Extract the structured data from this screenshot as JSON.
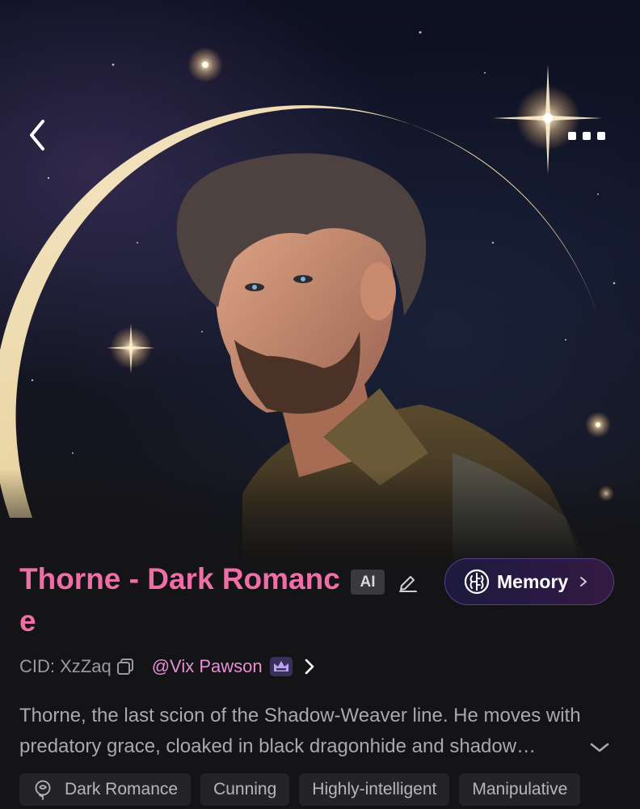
{
  "character": {
    "name": "Thorne - Dark Romance",
    "ai_badge": "AI",
    "memory_label": "Memory",
    "cid": "CID: XzZaq",
    "creator": "@Vix Pawson",
    "description": "Thorne, the last scion of the Shadow-Weaver line. He moves with predatory grace, cloaked in black dragonhide and shadow…"
  },
  "tags": [
    {
      "label": "Dark Romance",
      "icon": "rose-icon"
    },
    {
      "label": "Cunning"
    },
    {
      "label": "Highly-intelligent"
    },
    {
      "label": "Manipulative"
    }
  ],
  "icons": {
    "back": "chevron-left-icon",
    "more": "more-dots-icon",
    "edit": "pencil-icon",
    "memory": "brain-icon",
    "copy": "copy-icon",
    "creator_badge": "crown-icon",
    "expand": "chevron-down-icon"
  },
  "colors": {
    "title": "#f06ea6",
    "creator": "#e58fd4",
    "background": "#141416",
    "memory_border": "#5a3f8a",
    "crown": "#b9a4f5"
  }
}
